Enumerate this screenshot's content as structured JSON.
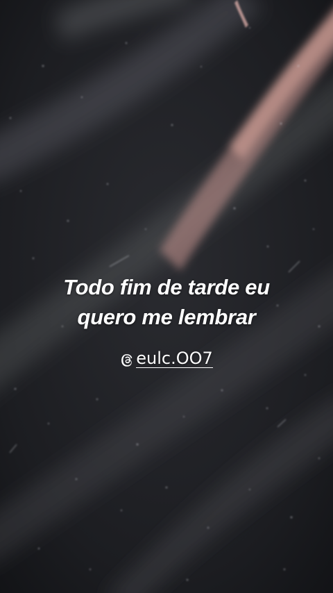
{
  "caption": {
    "line1": "Todo fim de tarde eu",
    "line2": "quero me lembrar"
  },
  "credit": {
    "handle": "eulc.OO7",
    "icon": "threads-icon"
  },
  "colors": {
    "background": "#1d1e22",
    "light_streak": "#e8a8a0",
    "text": "#ffffff"
  }
}
